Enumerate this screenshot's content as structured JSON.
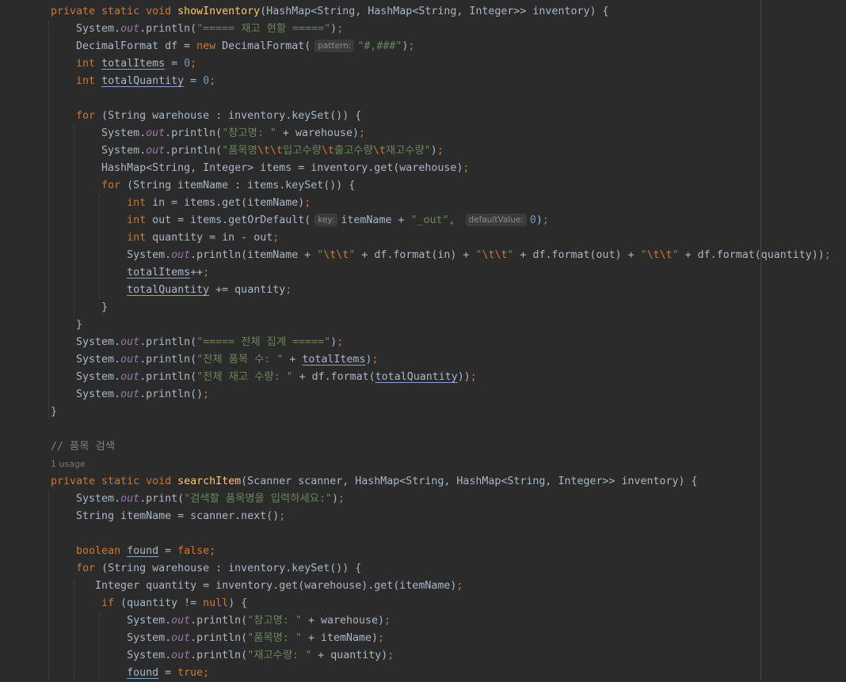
{
  "editor": {
    "language": "java",
    "colors": {
      "background": "#2b2b2b",
      "keyword": "#cc7832",
      "method": "#ffc66d",
      "string": "#6a8759",
      "number": "#6897bb",
      "field": "#9876aa",
      "text": "#a9b7c6",
      "comment": "#808080"
    },
    "lines": [
      [
        [
          "k",
          "private static void "
        ],
        [
          "m",
          "showInventory"
        ],
        [
          "t",
          "(HashMap<String, HashMap<String, Integer>> inventory) {"
        ]
      ],
      [
        [
          "t",
          "    System."
        ],
        [
          "f",
          "out"
        ],
        [
          "t",
          ".println("
        ],
        [
          "s",
          "\"===== 재고 현황 =====\""
        ],
        [
          "t",
          ")"
        ],
        [
          "k",
          ";"
        ]
      ],
      [
        [
          "t",
          "    DecimalFormat df = "
        ],
        [
          "k",
          "new "
        ],
        [
          "t",
          "DecimalFormat("
        ],
        [
          "h",
          "pattern:"
        ],
        [
          "s",
          "\"#,###\""
        ],
        [
          "t",
          ")"
        ],
        [
          "k",
          ";"
        ]
      ],
      [
        [
          "t",
          "    "
        ],
        [
          "k",
          "int "
        ],
        [
          "u",
          "totalItems"
        ],
        [
          "t",
          " = "
        ],
        [
          "n",
          "0"
        ],
        [
          "k",
          ";"
        ]
      ],
      [
        [
          "t",
          "    "
        ],
        [
          "k",
          "int "
        ],
        [
          "u",
          "totalQuantity"
        ],
        [
          "t",
          " = "
        ],
        [
          "n",
          "0"
        ],
        [
          "k",
          ";"
        ]
      ],
      [],
      [
        [
          "t",
          "    "
        ],
        [
          "k",
          "for "
        ],
        [
          "t",
          "(String warehouse : inventory.keySet()) {"
        ]
      ],
      [
        [
          "t",
          "        System."
        ],
        [
          "f",
          "out"
        ],
        [
          "t",
          ".println("
        ],
        [
          "s",
          "\"창고명: \""
        ],
        [
          "t",
          " + warehouse)"
        ],
        [
          "k",
          ";"
        ]
      ],
      [
        [
          "t",
          "        System."
        ],
        [
          "f",
          "out"
        ],
        [
          "t",
          ".println("
        ],
        [
          "s",
          "\"품목명"
        ],
        [
          "e",
          "\\t\\t"
        ],
        [
          "s",
          "입고수량"
        ],
        [
          "e",
          "\\t"
        ],
        [
          "s",
          "출고수량"
        ],
        [
          "e",
          "\\t"
        ],
        [
          "s",
          "재고수량\""
        ],
        [
          "t",
          ")"
        ],
        [
          "k",
          ";"
        ]
      ],
      [
        [
          "t",
          "        HashMap<String, Integer> items = inventory.get(warehouse)"
        ],
        [
          "k",
          ";"
        ]
      ],
      [
        [
          "t",
          "        "
        ],
        [
          "k",
          "for "
        ],
        [
          "t",
          "(String itemName : items.keySet()) {"
        ]
      ],
      [
        [
          "t",
          "            "
        ],
        [
          "k",
          "int "
        ],
        [
          "t",
          "in = items.get(itemName)"
        ],
        [
          "k",
          ";"
        ]
      ],
      [
        [
          "t",
          "            "
        ],
        [
          "k",
          "int "
        ],
        [
          "t",
          "out = items.getOrDefault("
        ],
        [
          "h",
          "key:"
        ],
        [
          "t",
          "itemName + "
        ],
        [
          "s",
          "\"_out\""
        ],
        [
          "k",
          ", "
        ],
        [
          "h",
          "defaultValue:"
        ],
        [
          "n",
          "0"
        ],
        [
          "t",
          ")"
        ],
        [
          "k",
          ";"
        ]
      ],
      [
        [
          "t",
          "            "
        ],
        [
          "k",
          "int "
        ],
        [
          "t",
          "quantity = in - out"
        ],
        [
          "k",
          ";"
        ]
      ],
      [
        [
          "t",
          "            System."
        ],
        [
          "f",
          "out"
        ],
        [
          "t",
          ".println(itemName + "
        ],
        [
          "s",
          "\""
        ],
        [
          "e",
          "\\t\\t"
        ],
        [
          "s",
          "\""
        ],
        [
          "t",
          " + df.format(in) + "
        ],
        [
          "s",
          "\""
        ],
        [
          "e",
          "\\t\\t"
        ],
        [
          "s",
          "\""
        ],
        [
          "t",
          " + df.format(out) + "
        ],
        [
          "s",
          "\""
        ],
        [
          "e",
          "\\t\\t"
        ],
        [
          "s",
          "\""
        ],
        [
          "t",
          " + df.format(quantity))"
        ],
        [
          "k",
          ";"
        ]
      ],
      [
        [
          "t",
          "            "
        ],
        [
          "u",
          "totalItems"
        ],
        [
          "t",
          "++"
        ],
        [
          "k",
          ";"
        ]
      ],
      [
        [
          "t",
          "            "
        ],
        [
          "u",
          "totalQuantity"
        ],
        [
          "t",
          " += quantity"
        ],
        [
          "k",
          ";"
        ]
      ],
      [
        [
          "t",
          "        }"
        ]
      ],
      [
        [
          "t",
          "    }"
        ]
      ],
      [
        [
          "t",
          "    System."
        ],
        [
          "f",
          "out"
        ],
        [
          "t",
          ".println("
        ],
        [
          "s",
          "\"===== 전체 집계 =====\""
        ],
        [
          "t",
          ")"
        ],
        [
          "k",
          ";"
        ]
      ],
      [
        [
          "t",
          "    System."
        ],
        [
          "f",
          "out"
        ],
        [
          "t",
          ".println("
        ],
        [
          "s",
          "\"전체 품목 수: \""
        ],
        [
          "t",
          " + "
        ],
        [
          "u",
          "totalItems"
        ],
        [
          "t",
          ")"
        ],
        [
          "k",
          ";"
        ]
      ],
      [
        [
          "t",
          "    System."
        ],
        [
          "f",
          "out"
        ],
        [
          "t",
          ".println("
        ],
        [
          "s",
          "\"전체 재고 수량: \""
        ],
        [
          "t",
          " + df.format("
        ],
        [
          "u",
          "totalQuantity"
        ],
        [
          "t",
          "))"
        ],
        [
          "k",
          ";"
        ]
      ],
      [
        [
          "t",
          "    System."
        ],
        [
          "f",
          "out"
        ],
        [
          "t",
          ".println()"
        ],
        [
          "k",
          ";"
        ]
      ],
      [
        [
          "t",
          "}"
        ]
      ],
      [],
      [
        [
          "c",
          "// 품목 검색"
        ]
      ],
      [
        [
          "g",
          "1 usage"
        ]
      ],
      [
        [
          "k",
          "private static void "
        ],
        [
          "m",
          "searchItem"
        ],
        [
          "t",
          "(Scanner scanner, HashMap<String, HashMap<String, Integer>> inventory) {"
        ]
      ],
      [
        [
          "t",
          "    System."
        ],
        [
          "f",
          "out"
        ],
        [
          "t",
          ".print("
        ],
        [
          "s",
          "\"검색할 품목명을 입력하세요:\""
        ],
        [
          "t",
          ")"
        ],
        [
          "k",
          ";"
        ]
      ],
      [
        [
          "t",
          "    String itemName = scanner.next()"
        ],
        [
          "k",
          ";"
        ]
      ],
      [],
      [
        [
          "t",
          "    "
        ],
        [
          "k",
          "boolean "
        ],
        [
          "u",
          "found"
        ],
        [
          "t",
          " = "
        ],
        [
          "k",
          "false;"
        ]
      ],
      [
        [
          "t",
          "    "
        ],
        [
          "k",
          "for "
        ],
        [
          "t",
          "(String warehouse : inventory.keySet()) {"
        ]
      ],
      [
        [
          "t",
          "       Integer quantity = inventory.get(warehouse).get(itemName)"
        ],
        [
          "k",
          ";"
        ]
      ],
      [
        [
          "t",
          "        "
        ],
        [
          "k",
          "if "
        ],
        [
          "t",
          "(quantity != "
        ],
        [
          "k",
          "null"
        ],
        [
          "t",
          ") {"
        ]
      ],
      [
        [
          "t",
          "            System."
        ],
        [
          "f",
          "out"
        ],
        [
          "t",
          ".println("
        ],
        [
          "s",
          "\"창고명: \""
        ],
        [
          "t",
          " + warehouse)"
        ],
        [
          "k",
          ";"
        ]
      ],
      [
        [
          "t",
          "            System."
        ],
        [
          "f",
          "out"
        ],
        [
          "t",
          ".println("
        ],
        [
          "s",
          "\"품목명: \""
        ],
        [
          "t",
          " + itemName)"
        ],
        [
          "k",
          ";"
        ]
      ],
      [
        [
          "t",
          "            System."
        ],
        [
          "f",
          "out"
        ],
        [
          "t",
          ".println("
        ],
        [
          "s",
          "\"재고수량: \""
        ],
        [
          "t",
          " + quantity)"
        ],
        [
          "k",
          ";"
        ]
      ],
      [
        [
          "t",
          "            "
        ],
        [
          "u",
          "found"
        ],
        [
          "t",
          " = "
        ],
        [
          "k",
          "true;"
        ]
      ]
    ]
  }
}
